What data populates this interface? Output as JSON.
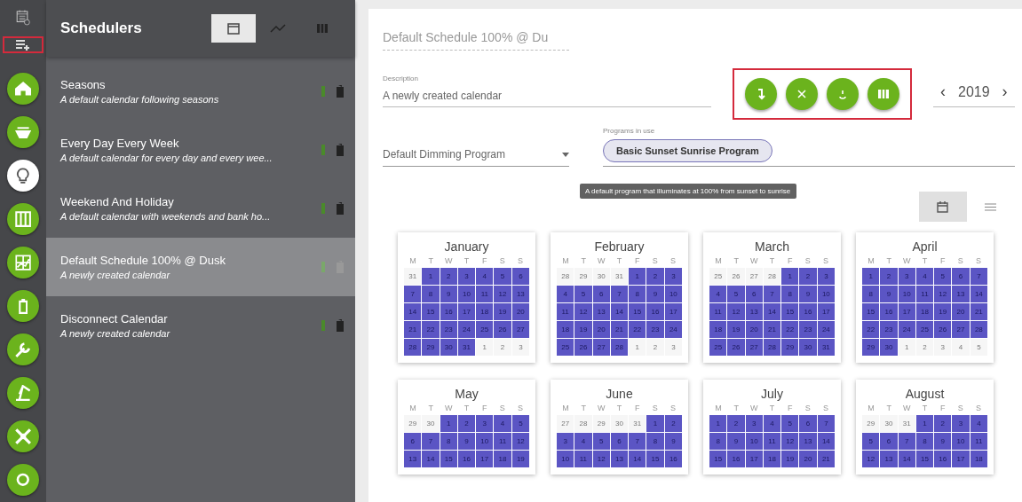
{
  "rail": [
    {
      "selected": false
    },
    {
      "selected": false
    },
    {
      "selected": true
    },
    {
      "selected": false
    },
    {
      "selected": false
    },
    {
      "selected": false
    },
    {
      "selected": false
    },
    {
      "selected": false
    },
    {
      "selected": false
    },
    {
      "selected": false
    }
  ],
  "sidebar": {
    "title": "Schedulers",
    "tabs": [
      {
        "selected": true
      },
      {
        "selected": false
      },
      {
        "selected": false
      }
    ],
    "items": [
      {
        "title": "Seasons",
        "subtitle": "A default calendar following seasons",
        "selected": false
      },
      {
        "title": "Every Day Every Week",
        "subtitle": "A default calendar for every day and every wee...",
        "selected": false
      },
      {
        "title": "Weekend And Holiday",
        "subtitle": "A default calendar with weekends and bank ho...",
        "selected": false
      },
      {
        "title": "Default Schedule 100% @ Dusk",
        "subtitle": "A newly created calendar",
        "selected": true
      },
      {
        "title": "Disconnect Calendar",
        "subtitle": "A newly created calendar",
        "selected": false
      }
    ]
  },
  "editor": {
    "name": "Default Schedule 100% @ Du",
    "description_label": "Description",
    "description": "A newly created calendar",
    "year_prev": "‹",
    "year": "2019",
    "year_next": "›",
    "program_select": "Default Dimming Program",
    "programs_label": "Programs in use",
    "program_chip": "Basic Sunset Sunrise Program",
    "tooltip": "A default program that illuminates at 100% from sunset to sunrise",
    "view_toggle": [
      {
        "selected": true
      },
      {
        "selected": false
      }
    ]
  },
  "months": [
    {
      "name": "January",
      "weekdays": [
        "M",
        "T",
        "W",
        "T",
        "F",
        "S",
        "S"
      ],
      "days": [
        {
          "day": "31",
          "selected": false
        },
        {
          "day": "1",
          "selected": true
        },
        {
          "day": "2",
          "selected": true
        },
        {
          "day": "3",
          "selected": true
        },
        {
          "day": "4",
          "selected": true
        },
        {
          "day": "5",
          "selected": true
        },
        {
          "day": "6",
          "selected": true
        },
        {
          "day": "7",
          "selected": true
        },
        {
          "day": "8",
          "selected": true
        },
        {
          "day": "9",
          "selected": true
        },
        {
          "day": "10",
          "selected": true
        },
        {
          "day": "11",
          "selected": true
        },
        {
          "day": "12",
          "selected": true
        },
        {
          "day": "13",
          "selected": true
        },
        {
          "day": "14",
          "selected": true
        },
        {
          "day": "15",
          "selected": true
        },
        {
          "day": "16",
          "selected": true
        },
        {
          "day": "17",
          "selected": true
        },
        {
          "day": "18",
          "selected": true
        },
        {
          "day": "19",
          "selected": true
        },
        {
          "day": "20",
          "selected": true
        },
        {
          "day": "21",
          "selected": true
        },
        {
          "day": "22",
          "selected": true
        },
        {
          "day": "23",
          "selected": true
        },
        {
          "day": "24",
          "selected": true
        },
        {
          "day": "25",
          "selected": true
        },
        {
          "day": "26",
          "selected": true
        },
        {
          "day": "27",
          "selected": true
        },
        {
          "day": "28",
          "selected": true
        },
        {
          "day": "29",
          "selected": true
        },
        {
          "day": "30",
          "selected": true
        },
        {
          "day": "31",
          "selected": true
        },
        {
          "day": "1",
          "selected": false
        },
        {
          "day": "2",
          "selected": false
        },
        {
          "day": "3",
          "selected": false
        }
      ]
    },
    {
      "name": "February",
      "weekdays": [
        "M",
        "T",
        "W",
        "T",
        "F",
        "S",
        "S"
      ],
      "days": [
        {
          "day": "28",
          "selected": false
        },
        {
          "day": "29",
          "selected": false
        },
        {
          "day": "30",
          "selected": false
        },
        {
          "day": "31",
          "selected": false
        },
        {
          "day": "1",
          "selected": true
        },
        {
          "day": "2",
          "selected": true
        },
        {
          "day": "3",
          "selected": true
        },
        {
          "day": "4",
          "selected": true
        },
        {
          "day": "5",
          "selected": true
        },
        {
          "day": "6",
          "selected": true
        },
        {
          "day": "7",
          "selected": true
        },
        {
          "day": "8",
          "selected": true
        },
        {
          "day": "9",
          "selected": true
        },
        {
          "day": "10",
          "selected": true
        },
        {
          "day": "11",
          "selected": true
        },
        {
          "day": "12",
          "selected": true
        },
        {
          "day": "13",
          "selected": true
        },
        {
          "day": "14",
          "selected": true
        },
        {
          "day": "15",
          "selected": true
        },
        {
          "day": "16",
          "selected": true
        },
        {
          "day": "17",
          "selected": true
        },
        {
          "day": "18",
          "selected": true
        },
        {
          "day": "19",
          "selected": true
        },
        {
          "day": "20",
          "selected": true
        },
        {
          "day": "21",
          "selected": true
        },
        {
          "day": "22",
          "selected": true
        },
        {
          "day": "23",
          "selected": true
        },
        {
          "day": "24",
          "selected": true
        },
        {
          "day": "25",
          "selected": true
        },
        {
          "day": "26",
          "selected": true
        },
        {
          "day": "27",
          "selected": true
        },
        {
          "day": "28",
          "selected": true
        },
        {
          "day": "1",
          "selected": false
        },
        {
          "day": "2",
          "selected": false
        },
        {
          "day": "3",
          "selected": false
        }
      ]
    },
    {
      "name": "March",
      "weekdays": [
        "M",
        "T",
        "W",
        "T",
        "F",
        "S",
        "S"
      ],
      "days": [
        {
          "day": "25",
          "selected": false
        },
        {
          "day": "26",
          "selected": false
        },
        {
          "day": "27",
          "selected": false
        },
        {
          "day": "28",
          "selected": false
        },
        {
          "day": "1",
          "selected": true
        },
        {
          "day": "2",
          "selected": true
        },
        {
          "day": "3",
          "selected": true
        },
        {
          "day": "4",
          "selected": true
        },
        {
          "day": "5",
          "selected": true
        },
        {
          "day": "6",
          "selected": true
        },
        {
          "day": "7",
          "selected": true
        },
        {
          "day": "8",
          "selected": true
        },
        {
          "day": "9",
          "selected": true
        },
        {
          "day": "10",
          "selected": true
        },
        {
          "day": "11",
          "selected": true
        },
        {
          "day": "12",
          "selected": true
        },
        {
          "day": "13",
          "selected": true
        },
        {
          "day": "14",
          "selected": true
        },
        {
          "day": "15",
          "selected": true
        },
        {
          "day": "16",
          "selected": true
        },
        {
          "day": "17",
          "selected": true
        },
        {
          "day": "18",
          "selected": true
        },
        {
          "day": "19",
          "selected": true
        },
        {
          "day": "20",
          "selected": true
        },
        {
          "day": "21",
          "selected": true
        },
        {
          "day": "22",
          "selected": true
        },
        {
          "day": "23",
          "selected": true
        },
        {
          "day": "24",
          "selected": true
        },
        {
          "day": "25",
          "selected": true
        },
        {
          "day": "26",
          "selected": true
        },
        {
          "day": "27",
          "selected": true
        },
        {
          "day": "28",
          "selected": true
        },
        {
          "day": "29",
          "selected": true
        },
        {
          "day": "30",
          "selected": true
        },
        {
          "day": "31",
          "selected": true
        }
      ]
    },
    {
      "name": "April",
      "weekdays": [
        "M",
        "T",
        "W",
        "T",
        "F",
        "S",
        "S"
      ],
      "days": [
        {
          "day": "1",
          "selected": true
        },
        {
          "day": "2",
          "selected": true
        },
        {
          "day": "3",
          "selected": true
        },
        {
          "day": "4",
          "selected": true
        },
        {
          "day": "5",
          "selected": true
        },
        {
          "day": "6",
          "selected": true
        },
        {
          "day": "7",
          "selected": true
        },
        {
          "day": "8",
          "selected": true
        },
        {
          "day": "9",
          "selected": true
        },
        {
          "day": "10",
          "selected": true
        },
        {
          "day": "11",
          "selected": true
        },
        {
          "day": "12",
          "selected": true
        },
        {
          "day": "13",
          "selected": true
        },
        {
          "day": "14",
          "selected": true
        },
        {
          "day": "15",
          "selected": true
        },
        {
          "day": "16",
          "selected": true
        },
        {
          "day": "17",
          "selected": true
        },
        {
          "day": "18",
          "selected": true
        },
        {
          "day": "19",
          "selected": true
        },
        {
          "day": "20",
          "selected": true
        },
        {
          "day": "21",
          "selected": true
        },
        {
          "day": "22",
          "selected": true
        },
        {
          "day": "23",
          "selected": true
        },
        {
          "day": "24",
          "selected": true
        },
        {
          "day": "25",
          "selected": true
        },
        {
          "day": "26",
          "selected": true
        },
        {
          "day": "27",
          "selected": true
        },
        {
          "day": "28",
          "selected": true
        },
        {
          "day": "29",
          "selected": true
        },
        {
          "day": "30",
          "selected": true
        },
        {
          "day": "1",
          "selected": false
        },
        {
          "day": "2",
          "selected": false
        },
        {
          "day": "3",
          "selected": false
        },
        {
          "day": "4",
          "selected": false
        },
        {
          "day": "5",
          "selected": false
        }
      ]
    },
    {
      "name": "May",
      "weekdays": [
        "M",
        "T",
        "W",
        "T",
        "F",
        "S",
        "S"
      ],
      "days": [
        {
          "day": "29",
          "selected": false
        },
        {
          "day": "30",
          "selected": false
        },
        {
          "day": "1",
          "selected": true
        },
        {
          "day": "2",
          "selected": true
        },
        {
          "day": "3",
          "selected": true
        },
        {
          "day": "4",
          "selected": true
        },
        {
          "day": "5",
          "selected": true
        },
        {
          "day": "6",
          "selected": true
        },
        {
          "day": "7",
          "selected": true
        },
        {
          "day": "8",
          "selected": true
        },
        {
          "day": "9",
          "selected": true
        },
        {
          "day": "10",
          "selected": true
        },
        {
          "day": "11",
          "selected": true
        },
        {
          "day": "12",
          "selected": true
        },
        {
          "day": "13",
          "selected": true
        },
        {
          "day": "14",
          "selected": true
        },
        {
          "day": "15",
          "selected": true
        },
        {
          "day": "16",
          "selected": true
        },
        {
          "day": "17",
          "selected": true
        },
        {
          "day": "18",
          "selected": true
        },
        {
          "day": "19",
          "selected": true
        }
      ]
    },
    {
      "name": "June",
      "weekdays": [
        "M",
        "T",
        "W",
        "T",
        "F",
        "S",
        "S"
      ],
      "days": [
        {
          "day": "27",
          "selected": false
        },
        {
          "day": "28",
          "selected": false
        },
        {
          "day": "29",
          "selected": false
        },
        {
          "day": "30",
          "selected": false
        },
        {
          "day": "31",
          "selected": false
        },
        {
          "day": "1",
          "selected": true
        },
        {
          "day": "2",
          "selected": true
        },
        {
          "day": "3",
          "selected": true
        },
        {
          "day": "4",
          "selected": true
        },
        {
          "day": "5",
          "selected": true
        },
        {
          "day": "6",
          "selected": true
        },
        {
          "day": "7",
          "selected": true
        },
        {
          "day": "8",
          "selected": true
        },
        {
          "day": "9",
          "selected": true
        },
        {
          "day": "10",
          "selected": true
        },
        {
          "day": "11",
          "selected": true
        },
        {
          "day": "12",
          "selected": true
        },
        {
          "day": "13",
          "selected": true
        },
        {
          "day": "14",
          "selected": true
        },
        {
          "day": "15",
          "selected": true
        },
        {
          "day": "16",
          "selected": true
        }
      ]
    },
    {
      "name": "July",
      "weekdays": [
        "M",
        "T",
        "W",
        "T",
        "F",
        "S",
        "S"
      ],
      "days": [
        {
          "day": "1",
          "selected": true
        },
        {
          "day": "2",
          "selected": true
        },
        {
          "day": "3",
          "selected": true
        },
        {
          "day": "4",
          "selected": true
        },
        {
          "day": "5",
          "selected": true
        },
        {
          "day": "6",
          "selected": true
        },
        {
          "day": "7",
          "selected": true
        },
        {
          "day": "8",
          "selected": true
        },
        {
          "day": "9",
          "selected": true
        },
        {
          "day": "10",
          "selected": true
        },
        {
          "day": "11",
          "selected": true
        },
        {
          "day": "12",
          "selected": true
        },
        {
          "day": "13",
          "selected": true
        },
        {
          "day": "14",
          "selected": true
        },
        {
          "day": "15",
          "selected": true
        },
        {
          "day": "16",
          "selected": true
        },
        {
          "day": "17",
          "selected": true
        },
        {
          "day": "18",
          "selected": true
        },
        {
          "day": "19",
          "selected": true
        },
        {
          "day": "20",
          "selected": true
        },
        {
          "day": "21",
          "selected": true
        }
      ]
    },
    {
      "name": "August",
      "weekdays": [
        "M",
        "T",
        "W",
        "T",
        "F",
        "S",
        "S"
      ],
      "days": [
        {
          "day": "29",
          "selected": false
        },
        {
          "day": "30",
          "selected": false
        },
        {
          "day": "31",
          "selected": false
        },
        {
          "day": "1",
          "selected": true
        },
        {
          "day": "2",
          "selected": true
        },
        {
          "day": "3",
          "selected": true
        },
        {
          "day": "4",
          "selected": true
        },
        {
          "day": "5",
          "selected": true
        },
        {
          "day": "6",
          "selected": true
        },
        {
          "day": "7",
          "selected": true
        },
        {
          "day": "8",
          "selected": true
        },
        {
          "day": "9",
          "selected": true
        },
        {
          "day": "10",
          "selected": true
        },
        {
          "day": "11",
          "selected": true
        },
        {
          "day": "12",
          "selected": true
        },
        {
          "day": "13",
          "selected": true
        },
        {
          "day": "14",
          "selected": true
        },
        {
          "day": "15",
          "selected": true
        },
        {
          "day": "16",
          "selected": true
        },
        {
          "day": "17",
          "selected": true
        },
        {
          "day": "18",
          "selected": true
        }
      ]
    }
  ]
}
